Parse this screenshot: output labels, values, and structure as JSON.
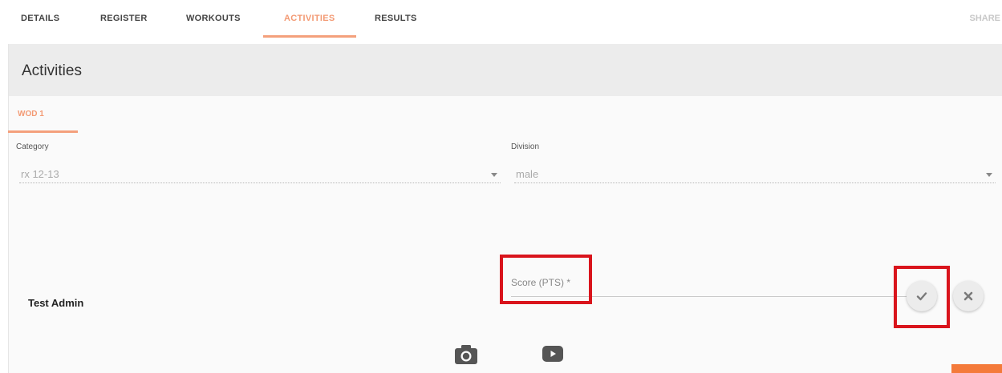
{
  "nav": {
    "tabs": [
      "DETAILS",
      "REGISTER",
      "WORKOUTS",
      "ACTIVITIES",
      "RESULTS"
    ],
    "active_tab": "ACTIVITIES",
    "share_label": "SHARE"
  },
  "panel": {
    "title": "Activities"
  },
  "wod_tab": "WOD 1",
  "category": {
    "label": "Category",
    "value": "rx 12-13"
  },
  "division": {
    "label": "Division",
    "value": "male"
  },
  "entry": {
    "athlete": "Test Admin",
    "score_label": "Score (PTS) *"
  },
  "icons": {
    "confirm": "check-icon",
    "cancel": "close-icon",
    "photo": "camera-icon",
    "video": "youtube-icon"
  },
  "colors": {
    "accent": "#f39a74",
    "highlight": "#d9141c"
  }
}
